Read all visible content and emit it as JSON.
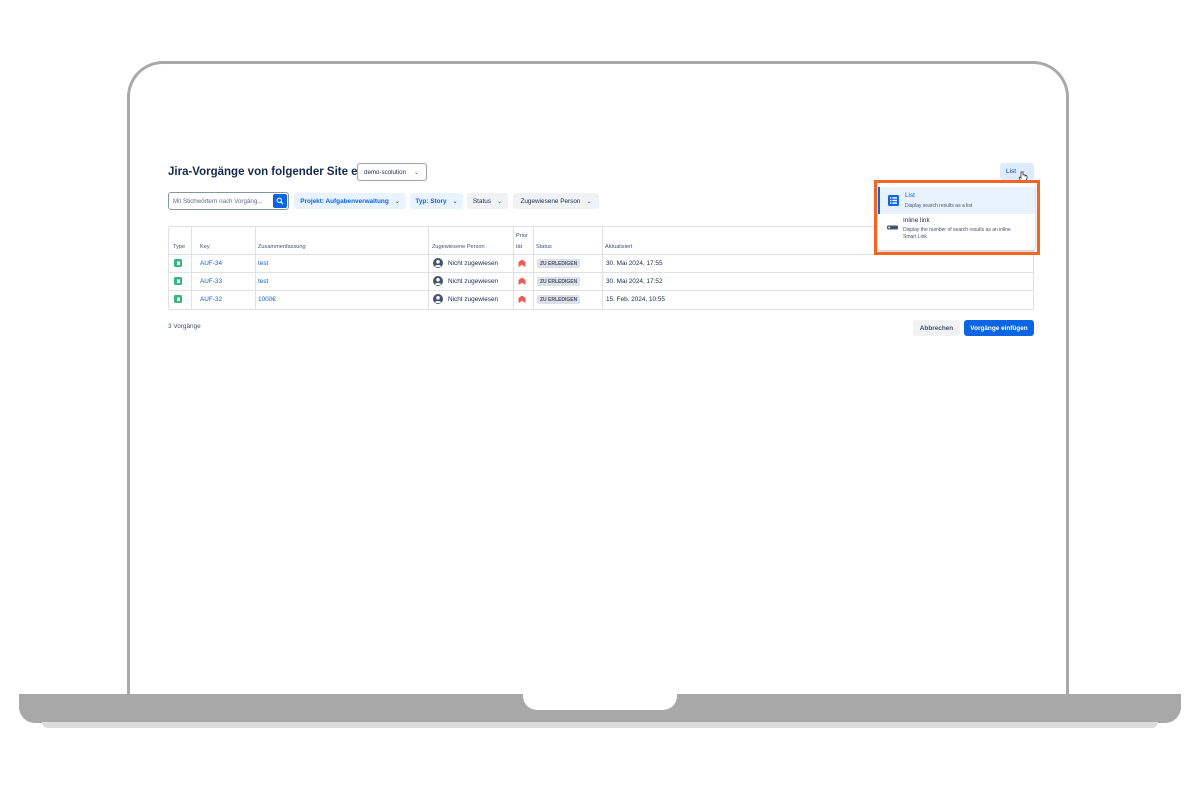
{
  "dialog": {
    "title": "Jira-Vorgänge von folgender Site einfügen:",
    "site": "demo-scolution",
    "view_toggle": "List"
  },
  "filters": {
    "search_placeholder": "Mit Stichwörtern nach Vorgäng...",
    "project": "Projekt: Aufgabenverwaltung",
    "type": "Typ: Story",
    "status": "Status",
    "assignee": "Zugewiesene Person"
  },
  "table": {
    "headers": {
      "type": "Type",
      "key": "Key",
      "summary": "Zusammenfassung",
      "assignee": "Zugewiesene Person",
      "priority_line1": "Prior",
      "priority_line2": "tät",
      "status": "Status",
      "updated": "Aktualisiert"
    },
    "rows": [
      {
        "key": "AUF-34",
        "summary": "test",
        "assignee": "Nicht zugewiesen",
        "status": "ZU ERLEDIGEN",
        "updated": "30. Mai 2024, 17:55"
      },
      {
        "key": "AUF-33",
        "summary": "test",
        "assignee": "Nicht zugewiesen",
        "status": "ZU ERLEDIGEN",
        "updated": "30. Mai 2024, 17:52"
      },
      {
        "key": "AUF-32",
        "summary": "1000€",
        "assignee": "Nicht zugewiesen",
        "status": "ZU ERLEDIGEN",
        "updated": "15. Feb. 2024, 10:55"
      }
    ]
  },
  "footer": {
    "count": "3 Vorgänge",
    "cancel": "Abbrechen",
    "insert": "Vorgänge einfügen"
  },
  "view_menu": {
    "items": [
      {
        "title": "List",
        "description": "Display search results as a list",
        "selected": true,
        "icon": "list-icon"
      },
      {
        "title": "Inline link",
        "description": "Display the number of search results as an inline Smart Link",
        "selected": false,
        "icon": "inline-link-icon"
      }
    ]
  },
  "colors": {
    "accent": "#0c66e4",
    "story": "#36b37e",
    "priority": "#f15b50",
    "highlight": "#f26522"
  }
}
